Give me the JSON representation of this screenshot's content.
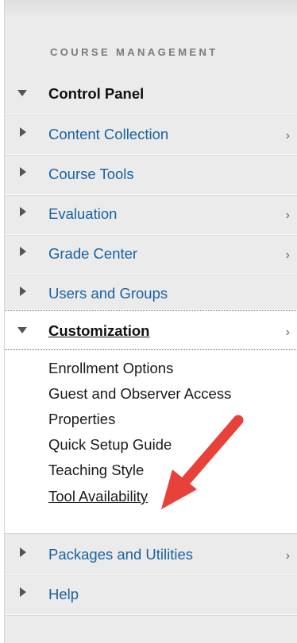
{
  "section_title": "COURSE MANAGEMENT",
  "control_panel": {
    "label": "Control Panel"
  },
  "menu_items": [
    {
      "label": "Content Collection",
      "has_submenu": true
    },
    {
      "label": "Course Tools",
      "has_submenu": false
    },
    {
      "label": "Evaluation",
      "has_submenu": true
    },
    {
      "label": "Grade Center",
      "has_submenu": true
    },
    {
      "label": "Users and Groups",
      "has_submenu": false
    }
  ],
  "customization": {
    "label": "Customization",
    "sub_items": [
      "Enrollment Options",
      "Guest and Observer Access",
      "Properties",
      "Quick Setup Guide",
      "Teaching Style",
      "Tool Availability"
    ],
    "active_item": "Tool Availability"
  },
  "bottom_items": [
    {
      "label": "Packages and Utilities",
      "has_submenu": true
    },
    {
      "label": "Help",
      "has_submenu": false
    }
  ],
  "submenu_chevron": "›",
  "annotation": {
    "type": "red-arrow",
    "color": "#e8413a"
  },
  "colors": {
    "link": "#1a62a0",
    "panel_bg": "#ebebeb",
    "arrow": "#e8413a"
  }
}
